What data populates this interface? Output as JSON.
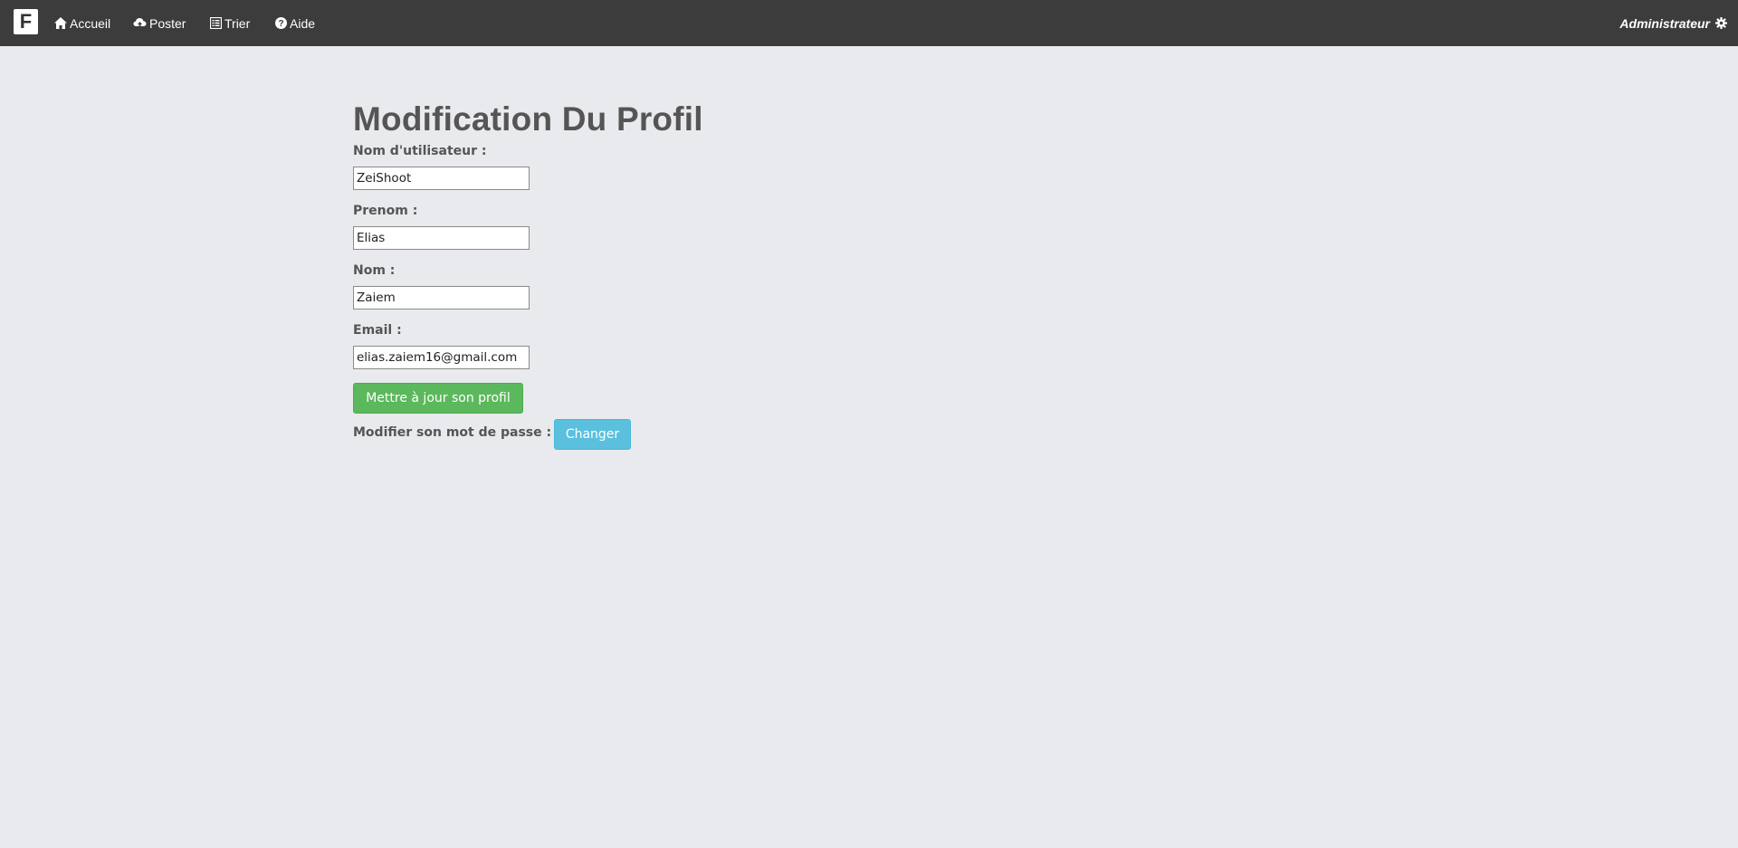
{
  "navbar": {
    "brand": "F",
    "items": [
      {
        "label": "Accueil",
        "icon": "home-icon"
      },
      {
        "label": "Poster",
        "icon": "cloud-upload-icon"
      },
      {
        "label": "Trier",
        "icon": "list-alt-icon"
      },
      {
        "label": "Aide",
        "icon": "question-sign-icon"
      }
    ],
    "user": {
      "label": "Administrateur",
      "icon": "gear-icon"
    }
  },
  "page": {
    "title": "Modification Du Profil"
  },
  "form": {
    "username": {
      "label": "Nom d'utilisateur :",
      "value": "ZeiShoot"
    },
    "firstname": {
      "label": "Prenom :",
      "value": "Elias"
    },
    "lastname": {
      "label": "Nom :",
      "value": "Zaiem"
    },
    "email": {
      "label": "Email :",
      "value": "elias.zaiem16@gmail.com"
    },
    "update_button": "Mettre à jour son profil",
    "password_label": "Modifier son mot de passe :",
    "change_button": "Changer"
  },
  "colors": {
    "navbar_bg": "#3c3c3c",
    "page_bg": "#e9eaed",
    "success": "#5cb85c",
    "info": "#5bc0de"
  }
}
